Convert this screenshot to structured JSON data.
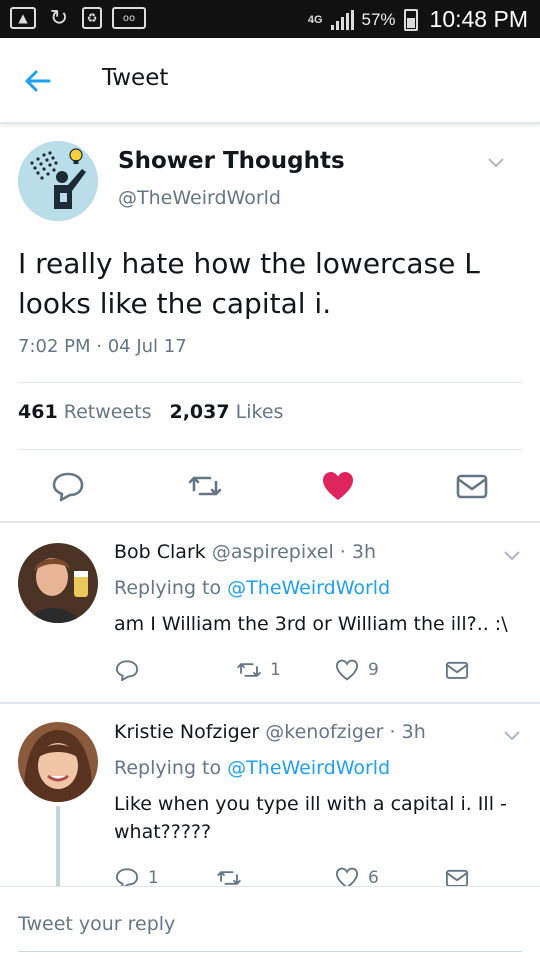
{
  "status_bar": {
    "network": "4G",
    "battery": "57%",
    "time": "10:48 PM"
  },
  "header": {
    "title": "Tweet"
  },
  "tweet": {
    "name": "Shower Thoughts",
    "handle": "@TheWeirdWorld",
    "text": "I really hate how the lowercase L looks like the capital i.",
    "time": "7:02 PM",
    "date": "04 Jul 17",
    "retweets_count": "461",
    "retweets_label": "Retweets",
    "likes_count": "2,037",
    "likes_label": "Likes",
    "liked_color": "#e0245e"
  },
  "replies": [
    {
      "name": "Bob Clark",
      "handle": "@aspirepixel",
      "age": "3h",
      "replying_prefix": "Replying to",
      "replying_to": "@TheWeirdWorld",
      "text": "am I William the 3rd or William the ill?.. :\\",
      "retweets": "1",
      "likes": "9"
    },
    {
      "name": "Kristie Nofziger",
      "handle": "@kenofziger",
      "age": "3h",
      "replying_prefix": "Replying to",
      "replying_to": "@TheWeirdWorld",
      "text": "Like when you type ill with a capital i. Ill - what?????",
      "replies": "1",
      "likes": "6"
    }
  ],
  "composer": {
    "placeholder": "Tweet your reply"
  },
  "colors": {
    "accent": "#1da1f2",
    "muted": "#657786",
    "divider": "#e1e8ed"
  }
}
